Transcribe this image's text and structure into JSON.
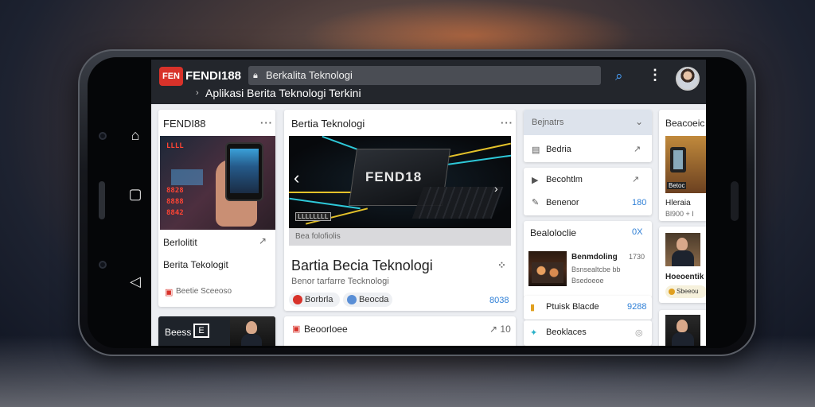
{
  "browser": {
    "logo_text": "FEN",
    "brand": "FENDI188",
    "url": "Berkalita Teknologi",
    "subtitle": "Aplikasi Berita Teknologi Terkini"
  },
  "left_card": {
    "title": "FENDI88",
    "img_overlay_lines": [
      "LLLL",
      "8828",
      "8888",
      "8842"
    ],
    "label1": "Berlolitit",
    "label1_meta": "↗",
    "label2": "Berita Tekologit",
    "footer": "Beetie Sceeoso"
  },
  "left_card2": {
    "title": "Beess",
    "icon_text": "E"
  },
  "main_card": {
    "title": "Bertia Teknologi",
    "chip_label": "FEND18",
    "img_tag": "LLLLLLLL",
    "img_caption": "Bea folofiolis",
    "headline": "Bartia Becia Teknologi",
    "subhead": "Benor tarfarre Tecknologi",
    "pill1": "Borbrla",
    "pill2": "Beocda",
    "count": "8038"
  },
  "main_card2": {
    "label": "Beoorloee",
    "meta": "↗ 10"
  },
  "sidebar": {
    "dropdown": "Bejnatrs",
    "item1": "Bedria",
    "item1_meta": "↗",
    "item2": "Becohtlm",
    "item2_meta": "↗",
    "item3": "Benenor",
    "item3_meta": "180",
    "section": "Bealoloclie",
    "section_meta": "0X",
    "news_title": "Benmdoling",
    "news_meta": "1730",
    "news_sub1": "Bsnsealtcbe bb",
    "news_sub2": "Bsedoeoe",
    "row1": "Ptuisk Blacde",
    "row1_meta": "9288",
    "row2": "Beoklaces"
  },
  "right_col": {
    "title": "Beacoeic",
    "card1_caption": "Betoc",
    "card1_sub": "Hleraia",
    "card1_meta": "Bl900 + I",
    "card2_caption": "Hoeoentik",
    "card2_sub": "Sbeeou"
  },
  "colors": {
    "accent": "#2e7fd6",
    "brand_red": "#d8322a",
    "topbar": "#23262c"
  }
}
